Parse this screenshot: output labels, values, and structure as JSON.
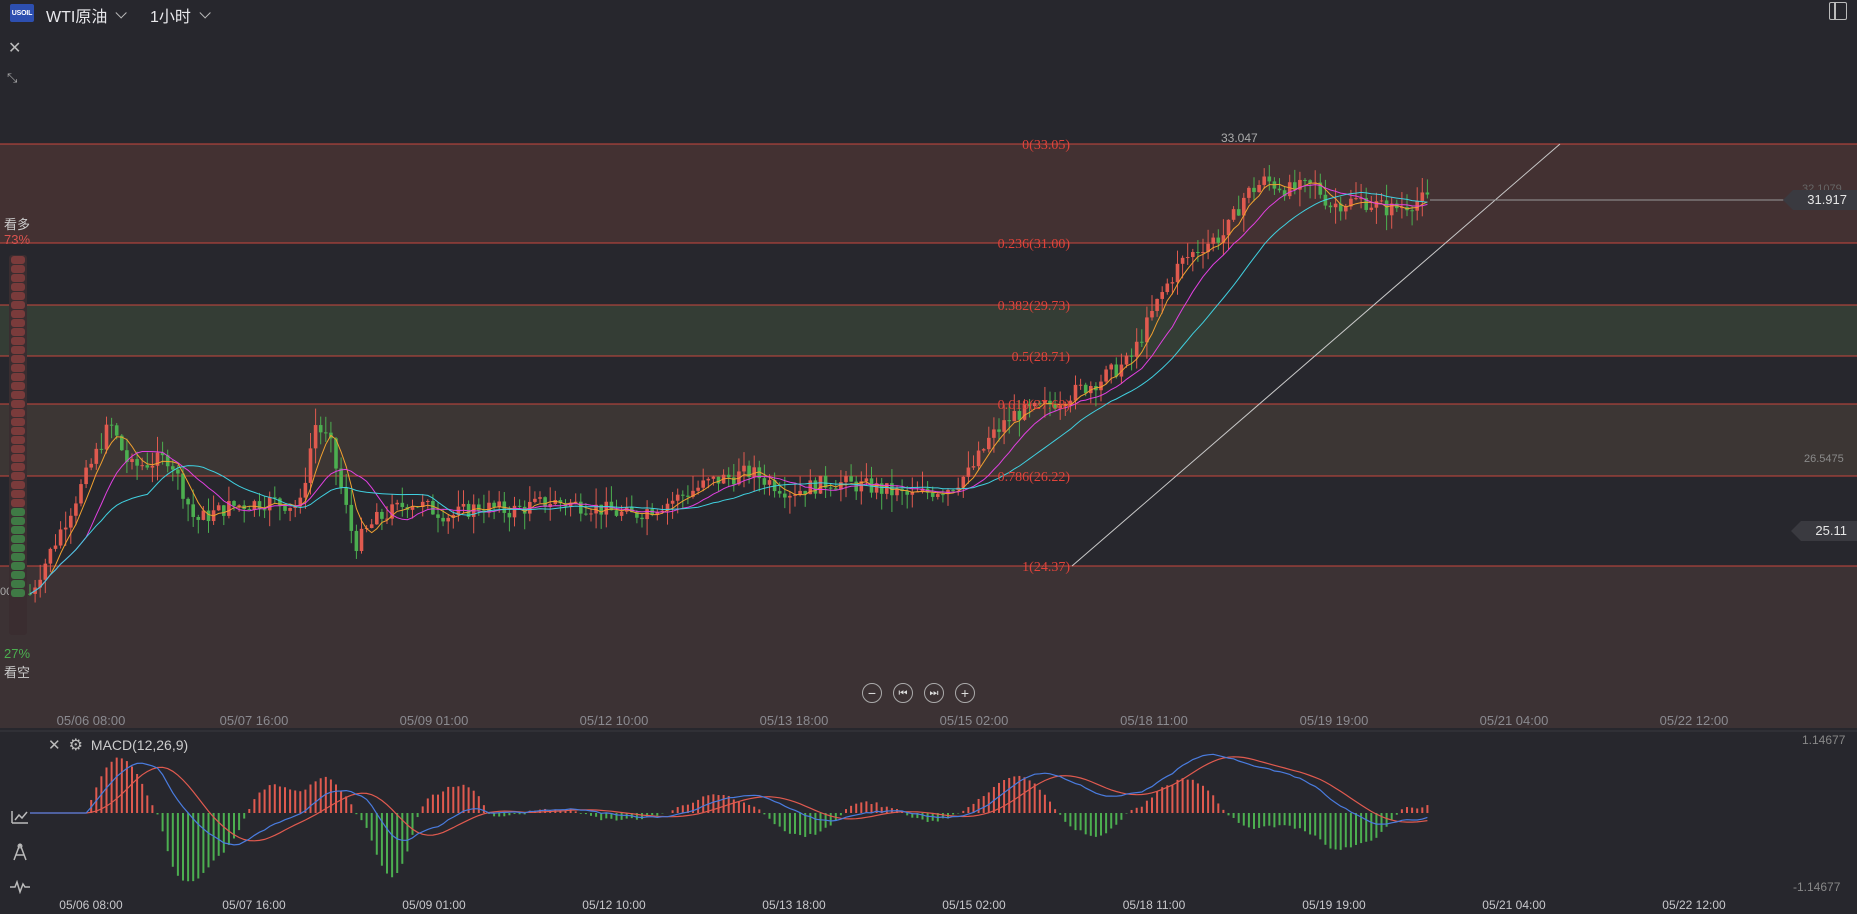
{
  "header": {
    "symbol_badge": "USOIL",
    "symbol": "WTI原油",
    "timeframe": "1小时"
  },
  "sentiment": {
    "bull_label": "看多",
    "bull_pct": "73%",
    "bear_label": "看空",
    "bear_pct": "27%",
    "bull_fraction": 0.73
  },
  "fibonacci": {
    "levels": [
      {
        "label": "0(33.05)",
        "price": 33.05
      },
      {
        "label": "0.236(31.00)",
        "price": 31.0
      },
      {
        "label": "0.382(29.73)",
        "price": 29.73
      },
      {
        "label": "0.5(28.71)",
        "price": 28.71
      },
      {
        "label": "0.618(27.68)",
        "price": 27.68
      },
      {
        "label": "0.786(26.22)",
        "price": 26.22
      },
      {
        "label": "1(24.37)",
        "price": 24.37
      }
    ]
  },
  "main_chart": {
    "high_label": "33.047",
    "current_price": "31.917",
    "ghost_price_top": "32.1079",
    "right_mid_price": "26.5475",
    "right_low_price": "25.11",
    "left_cut_price": "002"
  },
  "time_axis": [
    "05/06 08:00",
    "05/07 16:00",
    "05/09 01:00",
    "05/12 10:00",
    "05/13 18:00",
    "05/15 02:00",
    "05/18 11:00",
    "05/19 19:00",
    "05/21 04:00",
    "05/22 12:00"
  ],
  "macd": {
    "title": "MACD(12,26,9)",
    "top_value": "1.14677",
    "bottom_value": "-1.14677"
  },
  "colors": {
    "up": "#e05a4f",
    "down": "#4caf50",
    "fib_line": "#c8473d",
    "fib_text": "#e0433a",
    "ma_fast": "#f0a030",
    "ma_mid": "#e040e0",
    "ma_slow": "#40d0e0",
    "macd_line": "#4a7cdf",
    "signal_line": "#e05a4f"
  },
  "chart_data": {
    "type": "candlestick",
    "x": [
      "05/06 08:00",
      "05/07 16:00",
      "05/09 01:00",
      "05/12 10:00",
      "05/13 18:00",
      "05/15 02:00",
      "05/18 11:00",
      "05/19 19:00"
    ],
    "close": [
      26.0,
      26.3,
      25.9,
      26.1,
      26.3,
      26.7,
      31.5,
      31.917
    ],
    "y_range": [
      23.0,
      34.0
    ],
    "session_high": 33.047,
    "last_price": 31.917
  }
}
